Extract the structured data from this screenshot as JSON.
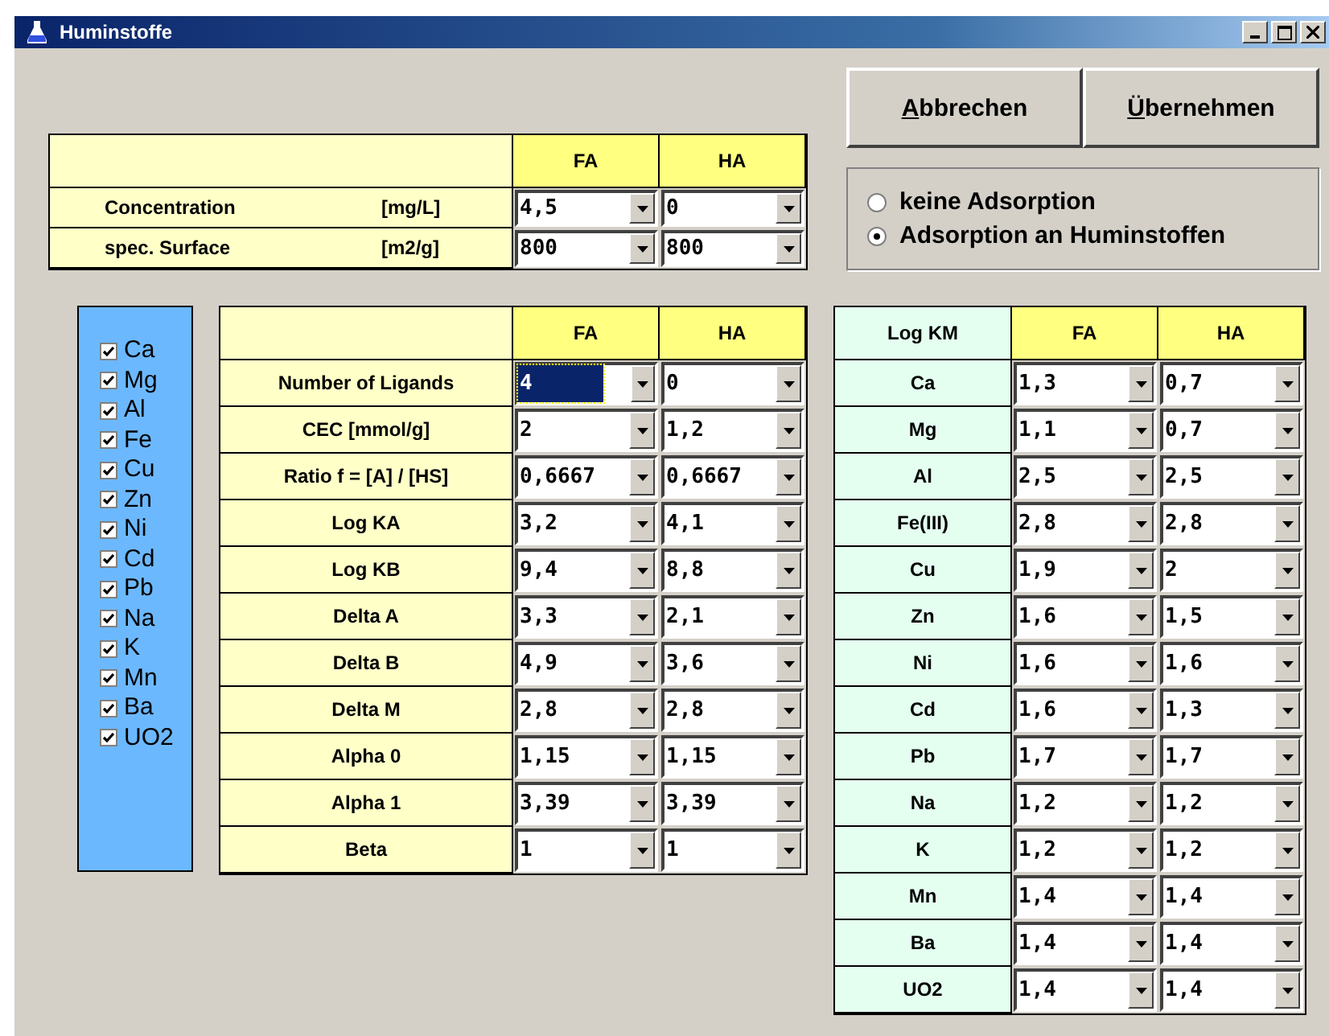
{
  "window": {
    "title": "Huminstoffe"
  },
  "buttons": [
    "Abbrechen",
    "Übernehmen"
  ],
  "surface_table": {
    "columns": [
      "FA",
      "HA"
    ],
    "rows": [
      {
        "label": "Concentration",
        "unit": "[mg/L]",
        "fa": {
          "value": "4,5",
          "focused": false
        },
        "ha": {
          "value": "0",
          "focused": false
        }
      },
      {
        "label": "spec. Surface",
        "unit": "[m2/g]",
        "fa": {
          "value": "800",
          "focused": false
        },
        "ha": {
          "value": "800",
          "focused": false
        }
      }
    ]
  },
  "adsorption": [
    {
      "label": "keine Adsorption",
      "selected": false
    },
    {
      "label": "Adsorption an Huminstoffen",
      "selected": true
    }
  ],
  "elements": [
    {
      "label": "Ca",
      "checked": true
    },
    {
      "label": "Mg",
      "checked": true
    },
    {
      "label": "Al",
      "checked": true
    },
    {
      "label": "Fe",
      "checked": true
    },
    {
      "label": "Cu",
      "checked": true
    },
    {
      "label": "Zn",
      "checked": true
    },
    {
      "label": "Ni",
      "checked": true
    },
    {
      "label": "Cd",
      "checked": true
    },
    {
      "label": "Pb",
      "checked": true
    },
    {
      "label": "Na",
      "checked": true
    },
    {
      "label": "K",
      "checked": true
    },
    {
      "label": "Mn",
      "checked": true
    },
    {
      "label": "Ba",
      "checked": true
    },
    {
      "label": "UO2",
      "checked": true
    }
  ],
  "parameter_table": {
    "columns": [
      "FA",
      "HA"
    ],
    "rows": [
      {
        "label": "Number of Ligands",
        "fa": {
          "value": "4",
          "focused": true
        },
        "ha": {
          "value": "0",
          "focused": false
        }
      },
      {
        "label": "CEC  [mmol/g]",
        "fa": {
          "value": "2",
          "focused": false
        },
        "ha": {
          "value": "1,2",
          "focused": false
        }
      },
      {
        "label": "Ratio f = [A] / [HS]",
        "fa": {
          "value": "0,6667",
          "focused": false
        },
        "ha": {
          "value": "0,6667",
          "focused": false
        }
      },
      {
        "label": "Log KA",
        "fa": {
          "value": "3,2",
          "focused": false
        },
        "ha": {
          "value": "4,1",
          "focused": false
        }
      },
      {
        "label": "Log KB",
        "fa": {
          "value": "9,4",
          "focused": false
        },
        "ha": {
          "value": "8,8",
          "focused": false
        }
      },
      {
        "label": "Delta A",
        "fa": {
          "value": "3,3",
          "focused": false
        },
        "ha": {
          "value": "2,1",
          "focused": false
        }
      },
      {
        "label": "Delta B",
        "fa": {
          "value": "4,9",
          "focused": false
        },
        "ha": {
          "value": "3,6",
          "focused": false
        }
      },
      {
        "label": "Delta M",
        "fa": {
          "value": "2,8",
          "focused": false
        },
        "ha": {
          "value": "2,8",
          "focused": false
        }
      },
      {
        "label": "Alpha 0",
        "fa": {
          "value": "1,15",
          "focused": false
        },
        "ha": {
          "value": "1,15",
          "focused": false
        }
      },
      {
        "label": "Alpha 1",
        "fa": {
          "value": "3,39",
          "focused": false
        },
        "ha": {
          "value": "3,39",
          "focused": false
        }
      },
      {
        "label": "Beta",
        "fa": {
          "value": "1",
          "focused": false
        },
        "ha": {
          "value": "1",
          "focused": false
        }
      }
    ]
  },
  "logkm_table": {
    "columns": [
      "Log KM",
      "FA",
      "HA"
    ],
    "rows": [
      {
        "label": "Ca",
        "fa": {
          "value": "1,3",
          "focused": false
        },
        "ha": {
          "value": "0,7",
          "focused": false
        }
      },
      {
        "label": "Mg",
        "fa": {
          "value": "1,1",
          "focused": false
        },
        "ha": {
          "value": "0,7",
          "focused": false
        }
      },
      {
        "label": "Al",
        "fa": {
          "value": "2,5",
          "focused": false
        },
        "ha": {
          "value": "2,5",
          "focused": false
        }
      },
      {
        "label": "Fe(III)",
        "fa": {
          "value": "2,8",
          "focused": false
        },
        "ha": {
          "value": "2,8",
          "focused": false
        }
      },
      {
        "label": "Cu",
        "fa": {
          "value": "1,9",
          "focused": false
        },
        "ha": {
          "value": "2",
          "focused": false
        }
      },
      {
        "label": "Zn",
        "fa": {
          "value": "1,6",
          "focused": false
        },
        "ha": {
          "value": "1,5",
          "focused": false
        }
      },
      {
        "label": "Ni",
        "fa": {
          "value": "1,6",
          "focused": false
        },
        "ha": {
          "value": "1,6",
          "focused": false
        }
      },
      {
        "label": "Cd",
        "fa": {
          "value": "1,6",
          "focused": false
        },
        "ha": {
          "value": "1,3",
          "focused": false
        }
      },
      {
        "label": "Pb",
        "fa": {
          "value": "1,7",
          "focused": false
        },
        "ha": {
          "value": "1,7",
          "focused": false
        }
      },
      {
        "label": "Na",
        "fa": {
          "value": "1,2",
          "focused": false
        },
        "ha": {
          "value": "1,2",
          "focused": false
        }
      },
      {
        "label": "K",
        "fa": {
          "value": "1,2",
          "focused": false
        },
        "ha": {
          "value": "1,2",
          "focused": false
        }
      },
      {
        "label": "Mn",
        "fa": {
          "value": "1,4",
          "focused": false
        },
        "ha": {
          "value": "1,4",
          "focused": false
        }
      },
      {
        "label": "Ba",
        "fa": {
          "value": "1,4",
          "focused": false
        },
        "ha": {
          "value": "1,4",
          "focused": false
        }
      },
      {
        "label": "UO2",
        "fa": {
          "value": "1,4",
          "focused": false
        },
        "ha": {
          "value": "1,4",
          "focused": false
        }
      }
    ]
  }
}
